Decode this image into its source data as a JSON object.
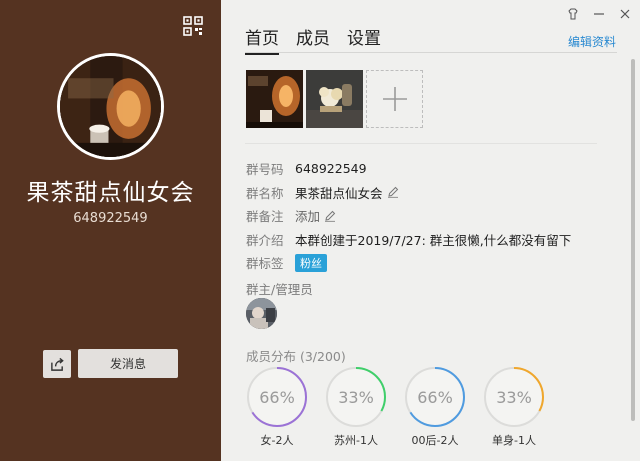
{
  "left": {
    "group_name": "果茶甜点仙女会",
    "group_id": "648922549",
    "send_message_label": "发消息",
    "colors": {
      "panel_bg": "#553321"
    }
  },
  "icons": {
    "qr": "qr-code-icon",
    "share": "share-icon",
    "skin": "skin-icon",
    "minimize": "minimize-icon",
    "close": "close-icon",
    "pencil": "pencil-icon",
    "add": "plus-icon"
  },
  "header": {
    "tabs": [
      "首页",
      "成员",
      "设置"
    ],
    "active_tab": 0,
    "edit_label": "编辑资料"
  },
  "info": {
    "group_no_label": "群号码",
    "group_no_value": "648922549",
    "group_name_label": "群名称",
    "group_name_value": "果茶甜点仙女会",
    "remark_label": "群备注",
    "remark_value": "添加",
    "intro_label": "群介绍",
    "intro_value": "本群创建于2019/7/27:  群主很懒,什么都没有留下",
    "tags_label": "群标签",
    "tag_value": "粉丝"
  },
  "admins": {
    "title": "群主/管理员"
  },
  "distribution": {
    "title": "成员分布 (3/200)",
    "items": [
      {
        "pct_label": "66%",
        "pct": 0.66,
        "label": "女-2人",
        "color": "#9b72d6"
      },
      {
        "pct_label": "33%",
        "pct": 0.33,
        "label": "苏州-1人",
        "color": "#3fcf6a"
      },
      {
        "pct_label": "66%",
        "pct": 0.66,
        "label": "00后-2人",
        "color": "#4f9be0"
      },
      {
        "pct_label": "33%",
        "pct": 0.33,
        "label": "单身-1人",
        "color": "#f0a72c"
      }
    ]
  }
}
